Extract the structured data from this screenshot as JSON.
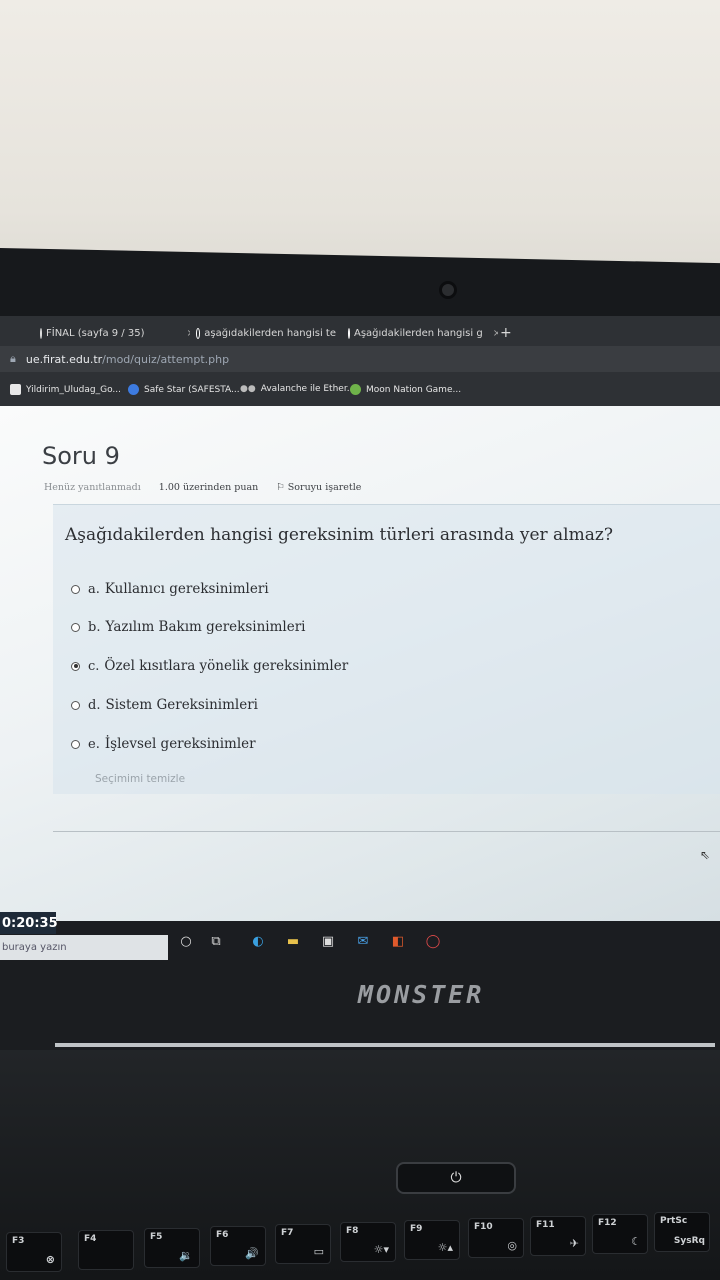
{
  "browser": {
    "tabs": [
      {
        "label": "FİNAL (sayfa 9 / 35)"
      },
      {
        "label": "aşağıdakilerden hangisi te"
      },
      {
        "label": "Aşağıdakilerden hangisi g"
      }
    ],
    "tab_close": "×",
    "new_tab": "+",
    "url_host": "ue.firat.edu.tr",
    "url_path": "/mod/quiz/attempt.php",
    "bookmarks": [
      {
        "label": "Yildirim_Uludag_Go..."
      },
      {
        "label": "Safe Star (SAFESTA..."
      },
      {
        "label": "Avalanche ile Ether..."
      },
      {
        "label": "Moon Nation Game..."
      }
    ]
  },
  "question": {
    "title": "Soru 9",
    "status": "Henüz yanıtlanmadı",
    "points": "1.00 üzerinden puan",
    "flag": "Soruyu işaretle",
    "text": "Aşağıdakilerden hangisi gereksinim türleri arasında yer almaz?",
    "options": [
      {
        "letter": "a.",
        "text": "Kullanıcı gereksinimleri",
        "selected": false
      },
      {
        "letter": "b.",
        "text": "Yazılım Bakım gereksinimleri",
        "selected": false
      },
      {
        "letter": "c.",
        "text": "Özel kısıtlara yönelik gereksinimler",
        "selected": true
      },
      {
        "letter": "d.",
        "text": "Sistem Gereksinimleri",
        "selected": false
      },
      {
        "letter": "e.",
        "text": "İşlevsel  gereksinimler",
        "selected": false
      }
    ],
    "clear_choice": "Seçimimi temizle"
  },
  "timer": "0:20:35",
  "taskbar": {
    "search_placeholder": "buraya yazın"
  },
  "laptop": {
    "brand": "MONSTER",
    "keys": [
      {
        "fn": "F3",
        "sym": "⊗"
      },
      {
        "fn": "F4",
        "sym": ""
      },
      {
        "fn": "F5",
        "sym": "🔉"
      },
      {
        "fn": "F6",
        "sym": "🔊"
      },
      {
        "fn": "F7",
        "sym": "▭"
      },
      {
        "fn": "F8",
        "sym": "☼▾"
      },
      {
        "fn": "F9",
        "sym": "☼▴"
      },
      {
        "fn": "F10",
        "sym": "◎"
      },
      {
        "fn": "F11",
        "sym": "✈"
      },
      {
        "fn": "F12",
        "sym": "☾"
      },
      {
        "fn": "PrtSc",
        "sym": "SysRq"
      }
    ]
  }
}
